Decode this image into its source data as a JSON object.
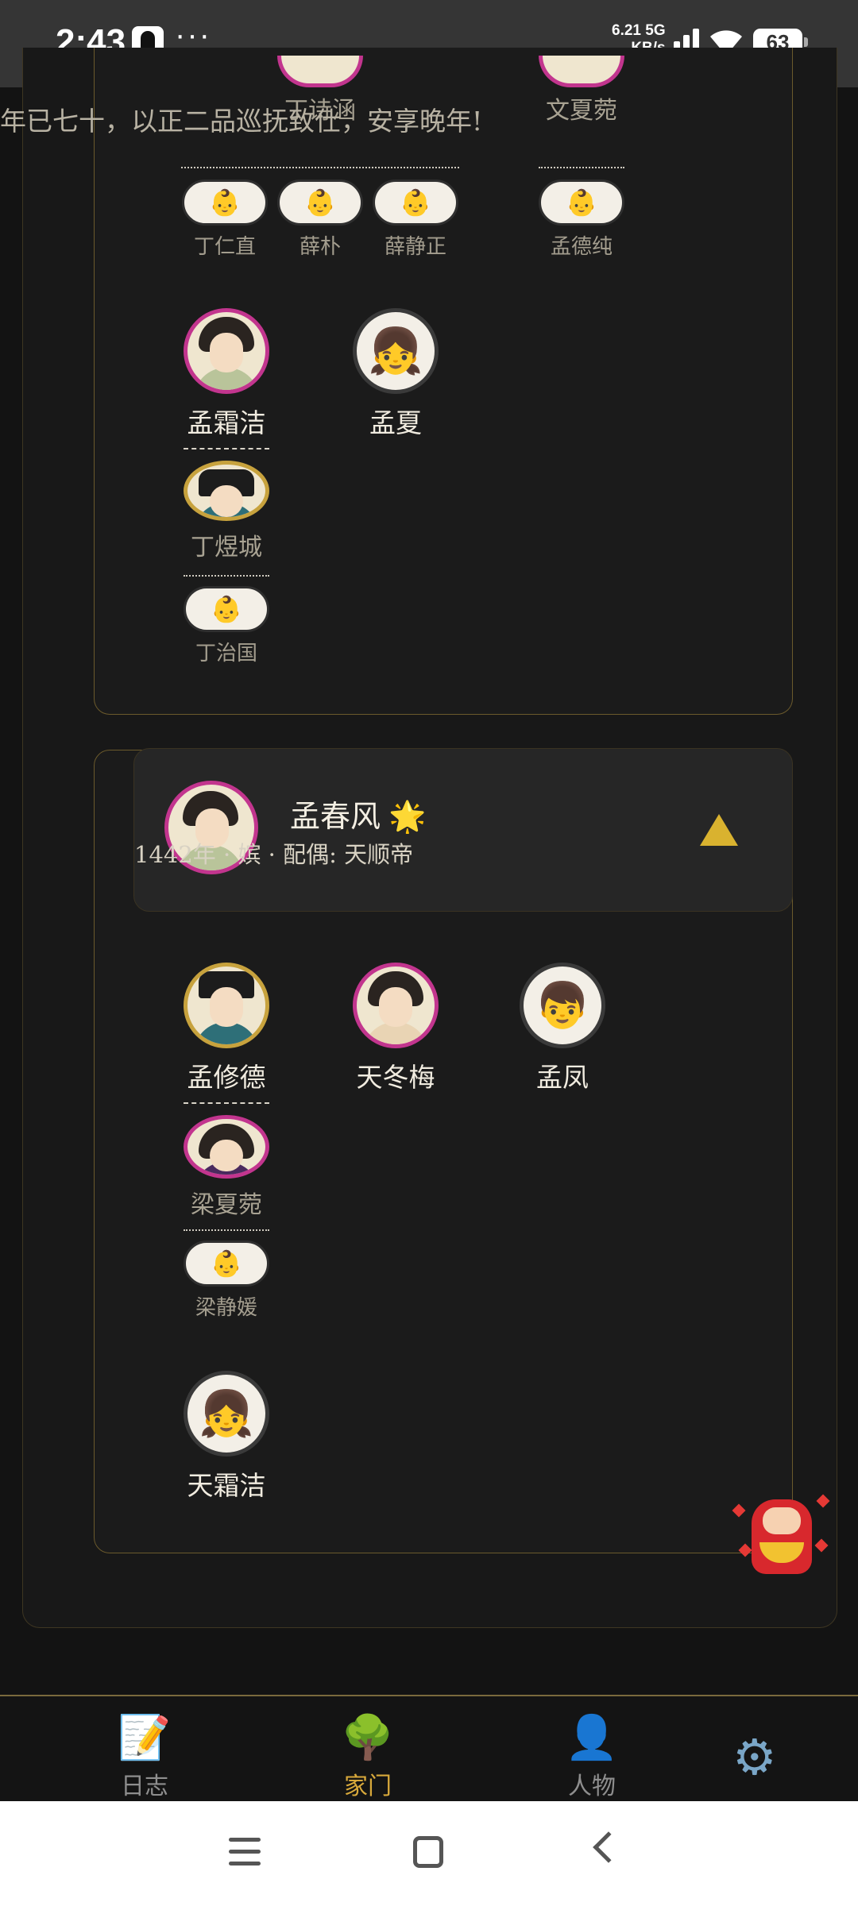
{
  "status_bar": {
    "time": "2:43",
    "dots": "···",
    "net_speed_value": "6.21",
    "net_speed_unit": "KB/s",
    "network_type": "5G",
    "battery": "63"
  },
  "marquee": {
    "text": "年已七十，以正二品巡抚致仕，安享晚年!"
  },
  "card_a": {
    "upper_children": [
      {
        "name": "丁诗涵"
      },
      {
        "name": "文夏菀"
      }
    ],
    "grandchildren_left": [
      {
        "icon": "👶",
        "name": "丁仁直"
      },
      {
        "icon": "👶",
        "name": "薛朴"
      },
      {
        "icon": "👶",
        "name": "薛静正"
      }
    ],
    "grandchildren_right": [
      {
        "icon": "👶",
        "name": "孟德纯"
      }
    ],
    "members": [
      {
        "name": "孟霜洁",
        "spouse": "丁煜城",
        "children": [
          {
            "icon": "👶",
            "name": "丁治国"
          }
        ]
      },
      {
        "icon": "👧",
        "name": "孟夏"
      }
    ]
  },
  "card_b": {
    "header": {
      "name": "孟春风",
      "star": "🌟",
      "subtitle": "1442年 · 嫔 · 配偶: 天顺帝"
    },
    "members": [
      {
        "name": "孟修德",
        "spouse": "梁夏菀",
        "children": [
          {
            "icon": "👶",
            "name": "梁静媛"
          }
        ]
      },
      {
        "name": "天冬梅"
      },
      {
        "icon": "👦",
        "name": "孟凤"
      },
      {
        "icon": "👧",
        "name": "天霜洁"
      }
    ]
  },
  "bottom_nav": {
    "items": [
      {
        "icon": "📝",
        "label": "日志"
      },
      {
        "icon": "🌳",
        "label": "家门"
      },
      {
        "icon": "👤",
        "label": "人物"
      }
    ],
    "settings_icon": "⚙"
  },
  "colors": {
    "accent_gold": "#d9b22f",
    "female_border": "#c2358e",
    "male_border": "#c7a23d",
    "active_nav": "#d8a93b"
  }
}
